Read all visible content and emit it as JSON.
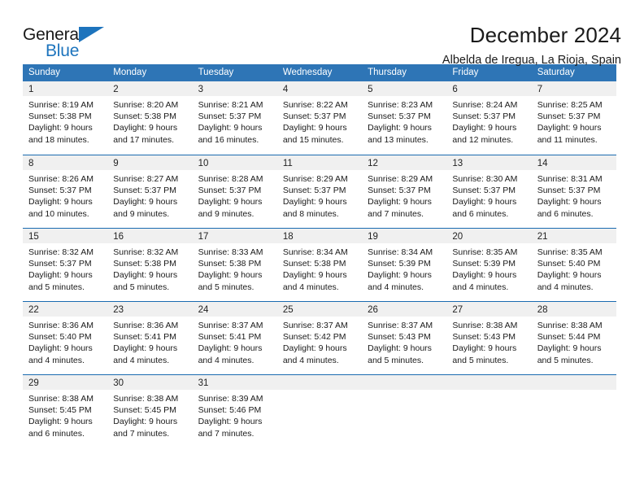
{
  "brand": {
    "name_part1": "General",
    "name_part2": "Blue",
    "triangle_color": "#1d74bd"
  },
  "header": {
    "title": "December 2024",
    "subtitle": "Albelda de Iregua, La Rioja, Spain"
  },
  "calendar": {
    "header_bg": "#2e75b6",
    "row_border": "#1a6bb0",
    "day_band_bg": "#f0f0f0",
    "weekdays": [
      "Sunday",
      "Monday",
      "Tuesday",
      "Wednesday",
      "Thursday",
      "Friday",
      "Saturday"
    ],
    "weeks": [
      [
        {
          "date": "1",
          "sunrise": "Sunrise: 8:19 AM",
          "sunset": "Sunset: 5:38 PM",
          "daylight1": "Daylight: 9 hours",
          "daylight2": "and 18 minutes."
        },
        {
          "date": "2",
          "sunrise": "Sunrise: 8:20 AM",
          "sunset": "Sunset: 5:38 PM",
          "daylight1": "Daylight: 9 hours",
          "daylight2": "and 17 minutes."
        },
        {
          "date": "3",
          "sunrise": "Sunrise: 8:21 AM",
          "sunset": "Sunset: 5:37 PM",
          "daylight1": "Daylight: 9 hours",
          "daylight2": "and 16 minutes."
        },
        {
          "date": "4",
          "sunrise": "Sunrise: 8:22 AM",
          "sunset": "Sunset: 5:37 PM",
          "daylight1": "Daylight: 9 hours",
          "daylight2": "and 15 minutes."
        },
        {
          "date": "5",
          "sunrise": "Sunrise: 8:23 AM",
          "sunset": "Sunset: 5:37 PM",
          "daylight1": "Daylight: 9 hours",
          "daylight2": "and 13 minutes."
        },
        {
          "date": "6",
          "sunrise": "Sunrise: 8:24 AM",
          "sunset": "Sunset: 5:37 PM",
          "daylight1": "Daylight: 9 hours",
          "daylight2": "and 12 minutes."
        },
        {
          "date": "7",
          "sunrise": "Sunrise: 8:25 AM",
          "sunset": "Sunset: 5:37 PM",
          "daylight1": "Daylight: 9 hours",
          "daylight2": "and 11 minutes."
        }
      ],
      [
        {
          "date": "8",
          "sunrise": "Sunrise: 8:26 AM",
          "sunset": "Sunset: 5:37 PM",
          "daylight1": "Daylight: 9 hours",
          "daylight2": "and 10 minutes."
        },
        {
          "date": "9",
          "sunrise": "Sunrise: 8:27 AM",
          "sunset": "Sunset: 5:37 PM",
          "daylight1": "Daylight: 9 hours",
          "daylight2": "and 9 minutes."
        },
        {
          "date": "10",
          "sunrise": "Sunrise: 8:28 AM",
          "sunset": "Sunset: 5:37 PM",
          "daylight1": "Daylight: 9 hours",
          "daylight2": "and 9 minutes."
        },
        {
          "date": "11",
          "sunrise": "Sunrise: 8:29 AM",
          "sunset": "Sunset: 5:37 PM",
          "daylight1": "Daylight: 9 hours",
          "daylight2": "and 8 minutes."
        },
        {
          "date": "12",
          "sunrise": "Sunrise: 8:29 AM",
          "sunset": "Sunset: 5:37 PM",
          "daylight1": "Daylight: 9 hours",
          "daylight2": "and 7 minutes."
        },
        {
          "date": "13",
          "sunrise": "Sunrise: 8:30 AM",
          "sunset": "Sunset: 5:37 PM",
          "daylight1": "Daylight: 9 hours",
          "daylight2": "and 6 minutes."
        },
        {
          "date": "14",
          "sunrise": "Sunrise: 8:31 AM",
          "sunset": "Sunset: 5:37 PM",
          "daylight1": "Daylight: 9 hours",
          "daylight2": "and 6 minutes."
        }
      ],
      [
        {
          "date": "15",
          "sunrise": "Sunrise: 8:32 AM",
          "sunset": "Sunset: 5:37 PM",
          "daylight1": "Daylight: 9 hours",
          "daylight2": "and 5 minutes."
        },
        {
          "date": "16",
          "sunrise": "Sunrise: 8:32 AM",
          "sunset": "Sunset: 5:38 PM",
          "daylight1": "Daylight: 9 hours",
          "daylight2": "and 5 minutes."
        },
        {
          "date": "17",
          "sunrise": "Sunrise: 8:33 AM",
          "sunset": "Sunset: 5:38 PM",
          "daylight1": "Daylight: 9 hours",
          "daylight2": "and 5 minutes."
        },
        {
          "date": "18",
          "sunrise": "Sunrise: 8:34 AM",
          "sunset": "Sunset: 5:38 PM",
          "daylight1": "Daylight: 9 hours",
          "daylight2": "and 4 minutes."
        },
        {
          "date": "19",
          "sunrise": "Sunrise: 8:34 AM",
          "sunset": "Sunset: 5:39 PM",
          "daylight1": "Daylight: 9 hours",
          "daylight2": "and 4 minutes."
        },
        {
          "date": "20",
          "sunrise": "Sunrise: 8:35 AM",
          "sunset": "Sunset: 5:39 PM",
          "daylight1": "Daylight: 9 hours",
          "daylight2": "and 4 minutes."
        },
        {
          "date": "21",
          "sunrise": "Sunrise: 8:35 AM",
          "sunset": "Sunset: 5:40 PM",
          "daylight1": "Daylight: 9 hours",
          "daylight2": "and 4 minutes."
        }
      ],
      [
        {
          "date": "22",
          "sunrise": "Sunrise: 8:36 AM",
          "sunset": "Sunset: 5:40 PM",
          "daylight1": "Daylight: 9 hours",
          "daylight2": "and 4 minutes."
        },
        {
          "date": "23",
          "sunrise": "Sunrise: 8:36 AM",
          "sunset": "Sunset: 5:41 PM",
          "daylight1": "Daylight: 9 hours",
          "daylight2": "and 4 minutes."
        },
        {
          "date": "24",
          "sunrise": "Sunrise: 8:37 AM",
          "sunset": "Sunset: 5:41 PM",
          "daylight1": "Daylight: 9 hours",
          "daylight2": "and 4 minutes."
        },
        {
          "date": "25",
          "sunrise": "Sunrise: 8:37 AM",
          "sunset": "Sunset: 5:42 PM",
          "daylight1": "Daylight: 9 hours",
          "daylight2": "and 4 minutes."
        },
        {
          "date": "26",
          "sunrise": "Sunrise: 8:37 AM",
          "sunset": "Sunset: 5:43 PM",
          "daylight1": "Daylight: 9 hours",
          "daylight2": "and 5 minutes."
        },
        {
          "date": "27",
          "sunrise": "Sunrise: 8:38 AM",
          "sunset": "Sunset: 5:43 PM",
          "daylight1": "Daylight: 9 hours",
          "daylight2": "and 5 minutes."
        },
        {
          "date": "28",
          "sunrise": "Sunrise: 8:38 AM",
          "sunset": "Sunset: 5:44 PM",
          "daylight1": "Daylight: 9 hours",
          "daylight2": "and 5 minutes."
        }
      ],
      [
        {
          "date": "29",
          "sunrise": "Sunrise: 8:38 AM",
          "sunset": "Sunset: 5:45 PM",
          "daylight1": "Daylight: 9 hours",
          "daylight2": "and 6 minutes."
        },
        {
          "date": "30",
          "sunrise": "Sunrise: 8:38 AM",
          "sunset": "Sunset: 5:45 PM",
          "daylight1": "Daylight: 9 hours",
          "daylight2": "and 7 minutes."
        },
        {
          "date": "31",
          "sunrise": "Sunrise: 8:39 AM",
          "sunset": "Sunset: 5:46 PM",
          "daylight1": "Daylight: 9 hours",
          "daylight2": "and 7 minutes."
        },
        {
          "date": "",
          "sunrise": "",
          "sunset": "",
          "daylight1": "",
          "daylight2": ""
        },
        {
          "date": "",
          "sunrise": "",
          "sunset": "",
          "daylight1": "",
          "daylight2": ""
        },
        {
          "date": "",
          "sunrise": "",
          "sunset": "",
          "daylight1": "",
          "daylight2": ""
        },
        {
          "date": "",
          "sunrise": "",
          "sunset": "",
          "daylight1": "",
          "daylight2": ""
        }
      ]
    ]
  }
}
